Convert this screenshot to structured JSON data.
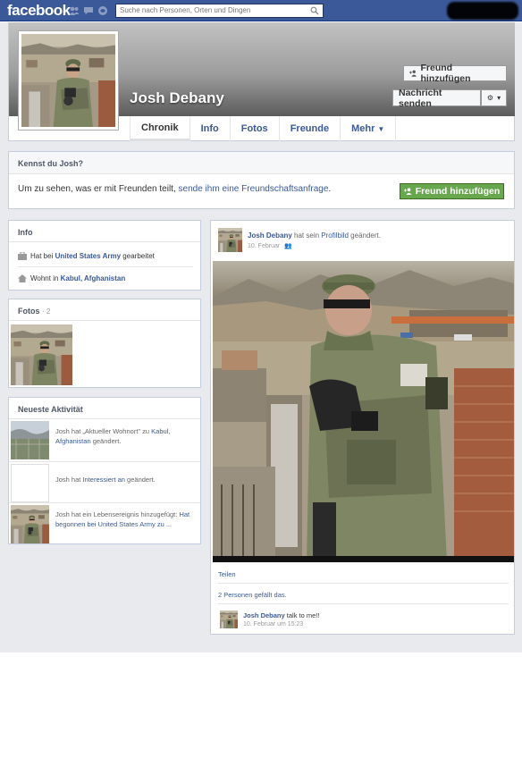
{
  "topbar": {
    "logo": "facebook",
    "search_placeholder": "Suche nach Personen, Orten und Dingen",
    "jewels": [
      "friend-requests-icon",
      "messages-icon",
      "notifications-icon"
    ]
  },
  "profile": {
    "name": "Josh Debany",
    "add_friend_label": "Freund hinzufügen",
    "message_label": "Nachricht senden",
    "tabs": [
      "Chronik",
      "Info",
      "Fotos",
      "Freunde",
      "Mehr"
    ]
  },
  "know": {
    "heading": "Kennst du Josh?",
    "text_prefix": "Um zu sehen, was er mit Freunden teilt, ",
    "text_link": "sende ihm eine Freundschaftsanfrage",
    "text_suffix": ".",
    "button_label": "Freund hinzufügen"
  },
  "info_box": {
    "heading": "Info",
    "work_prefix": "Hat bei ",
    "work_link": "United States Army",
    "work_suffix": " gearbeitet",
    "lives_prefix": "Wohnt in ",
    "lives_link": "Kabul, Afghanistan"
  },
  "photos_box": {
    "heading": "Fotos",
    "count": "· 2"
  },
  "activity_box": {
    "heading": "Neueste Aktivität",
    "items": [
      {
        "pre": "Josh hat „Aktueller Wohnort\" zu ",
        "link": "Kabul, Afghanistan",
        "post": " geändert."
      },
      {
        "pre": "Josh hat ",
        "link": "Interessiert an",
        "post": " geändert."
      },
      {
        "pre": "Josh hat ein Lebensereignis hinzugefügt: ",
        "link": "Hat begonnen bei United States Army zu ...",
        "post": ""
      }
    ]
  },
  "post": {
    "author": "Josh Debany",
    "action_pre": " hat sein ",
    "action_link": "Profilbild",
    "action_post": " geändert.",
    "date": "10. Februar",
    "share_label": "Teilen",
    "likes": "2 Personen gefällt das.",
    "comment_author": "Josh Debany",
    "comment_text": " talk to me!!",
    "comment_date": "10. Februar um 15:23"
  },
  "colors": {
    "brand": "#3b5998",
    "page_bg": "#e9eaed",
    "green_button": "#69a74e"
  }
}
